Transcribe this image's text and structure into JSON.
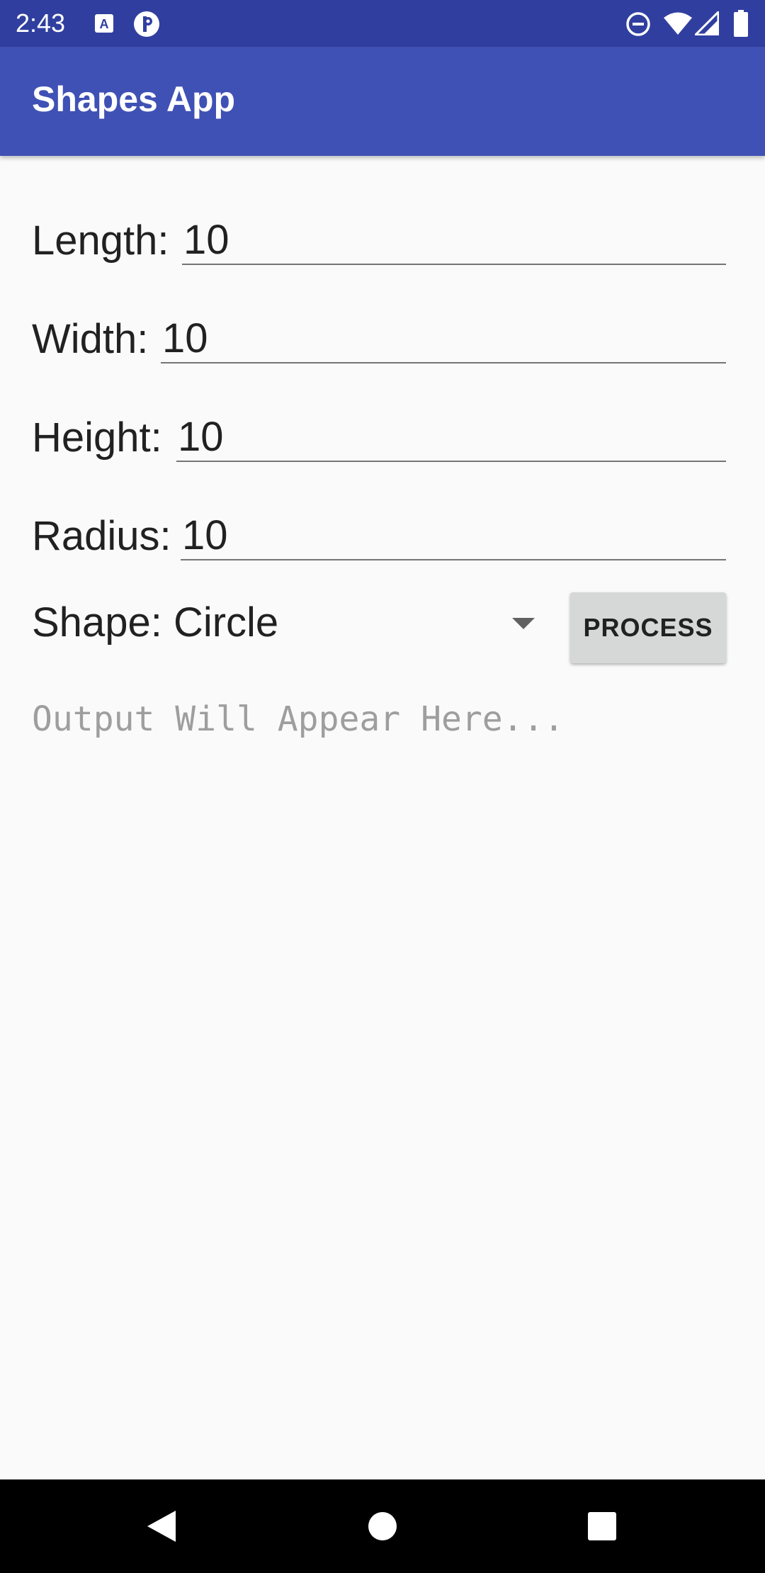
{
  "status_bar": {
    "time": "2:43"
  },
  "app_bar": {
    "title": "Shapes App"
  },
  "form": {
    "length": {
      "label": "Length:",
      "value": "10"
    },
    "width": {
      "label": "Width:",
      "value": "10"
    },
    "height": {
      "label": "Height:",
      "value": "10"
    },
    "radius": {
      "label": "Radius:",
      "value": "10"
    }
  },
  "shape_spinner": {
    "selected": "Shape: Circle"
  },
  "process_button": {
    "label": "PROCESS"
  },
  "output": {
    "placeholder": "Output Will Appear Here..."
  },
  "colors": {
    "status_bar": "#303f9f",
    "app_bar": "#3f51b5",
    "background": "#fafafa",
    "button": "#d6d7d7",
    "nav_bar": "#000000"
  },
  "icons": {
    "status_left": [
      "font-a-icon",
      "pinterest-icon"
    ],
    "status_right": [
      "do-not-disturb-icon",
      "wifi-icon",
      "signal-icon",
      "battery-icon"
    ],
    "navigation": [
      "back-icon",
      "home-icon",
      "recents-icon"
    ]
  }
}
